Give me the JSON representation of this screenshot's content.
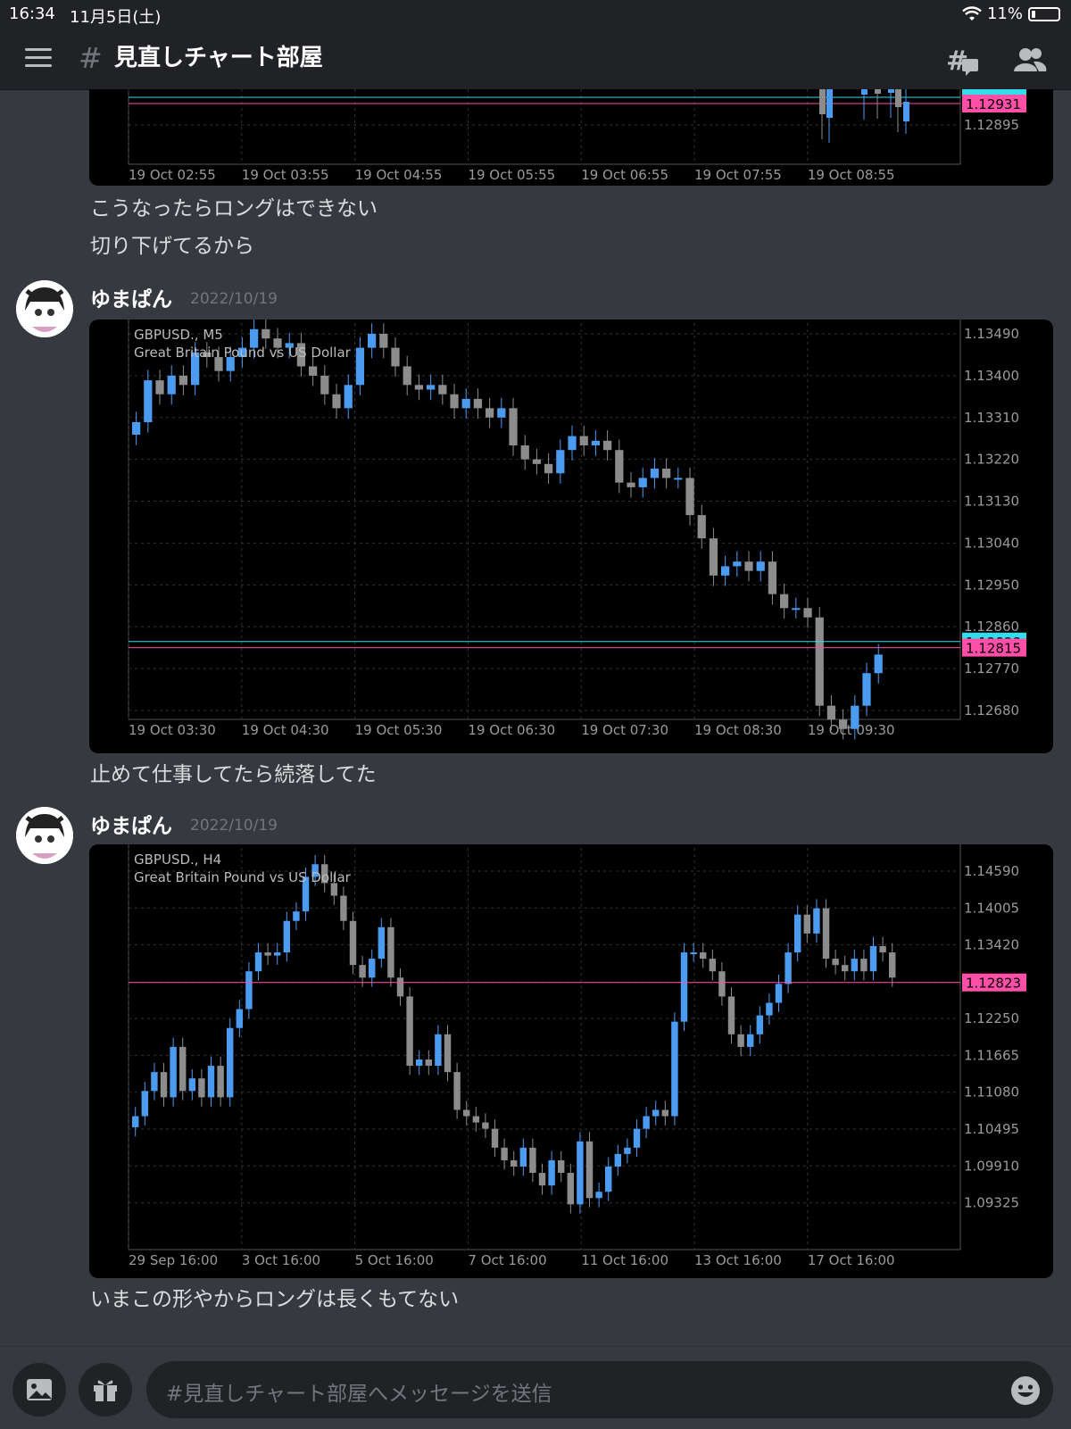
{
  "status": {
    "time": "16:34",
    "date": "11月5日(土)",
    "battery": "11%"
  },
  "header": {
    "hash": "#",
    "title": "見直しチャート部屋",
    "threads_icon": "threads-icon",
    "members_icon": "members-icon"
  },
  "messages_top": {
    "line1": "こうなったらロングはできない",
    "line2": "切り下げてるから"
  },
  "msg2": {
    "username": "ゆまぱん",
    "timestamp": "2022/10/19",
    "text": "止めて仕事してたら続落してた"
  },
  "msg3": {
    "username": "ゆまぱん",
    "timestamp": "2022/10/19",
    "text": "いまこの形やからロングは長くもてない"
  },
  "input": {
    "placeholder": "#見直しチャート部屋へメッセージを送信"
  },
  "colors": {
    "bg": "#36393f",
    "bar": "#202225",
    "bull": "#4b9cf0",
    "bear": "#8c8c8c",
    "price_tag": "#ff4fa7",
    "cyan_tag": "#33ddee"
  },
  "chart_data": [
    {
      "type": "candlestick",
      "symbol": "",
      "title": "",
      "y_ticks": [
        "1.12895"
      ],
      "x_ticks": [
        "19 Oct 02:55",
        "19 Oct 03:55",
        "19 Oct 04:55",
        "19 Oct 05:55",
        "19 Oct 06:55",
        "19 Oct 07:55",
        "19 Oct 08:55"
      ],
      "current_price": "1.12931",
      "cyan_price": "1.12941"
    },
    {
      "type": "candlestick",
      "symbol": "GBPUSD., M5",
      "title": "Great Britain Pound vs US Dollar",
      "y_ticks": [
        "1.13490",
        "1.13400",
        "1.13310",
        "1.13220",
        "1.13130",
        "1.13040",
        "1.12950",
        "1.12860",
        "1.12770",
        "1.12680"
      ],
      "x_ticks": [
        "19 Oct 03:30",
        "19 Oct 04:30",
        "19 Oct 05:30",
        "19 Oct 06:30",
        "19 Oct 07:30",
        "19 Oct 08:30",
        "19 Oct 09:30"
      ],
      "current_price": "1.12815",
      "cyan_price": "1.12828",
      "closes": [
        1.133,
        1.1339,
        1.1336,
        1.134,
        1.1338,
        1.1345,
        1.1344,
        1.1341,
        1.1344,
        1.1346,
        1.135,
        1.1348,
        1.1346,
        1.1347,
        1.1342,
        1.134,
        1.1336,
        1.1333,
        1.1338,
        1.1346,
        1.1349,
        1.1346,
        1.1342,
        1.1338,
        1.1337,
        1.1338,
        1.1336,
        1.1333,
        1.1335,
        1.1333,
        1.1331,
        1.1333,
        1.1325,
        1.1322,
        1.1321,
        1.1319,
        1.1324,
        1.1327,
        1.1325,
        1.1326,
        1.1324,
        1.1317,
        1.1316,
        1.1318,
        1.132,
        1.1318,
        1.1318,
        1.131,
        1.1305,
        1.1297,
        1.1299,
        1.13,
        1.1298,
        1.13,
        1.1293,
        1.129,
        1.129,
        1.1288,
        1.1269,
        1.1266,
        1.1264,
        1.1269,
        1.1276,
        1.128
      ]
    },
    {
      "type": "candlestick",
      "symbol": "GBPUSD., H4",
      "title": "Great Britain Pound vs US Dollar",
      "y_ticks": [
        "1.14590",
        "1.14005",
        "1.13420",
        "1.12823",
        "1.12250",
        "1.11665",
        "1.11080",
        "1.10495",
        "1.09910",
        "1.09325"
      ],
      "x_ticks": [
        "29 Sep 16:00",
        "3 Oct 16:00",
        "5 Oct 16:00",
        "7 Oct 16:00",
        "11 Oct 16:00",
        "13 Oct 16:00",
        "17 Oct 16:00"
      ],
      "current_price": "1.12823",
      "closes": [
        1.107,
        1.111,
        1.114,
        1.11,
        1.118,
        1.111,
        1.113,
        1.11,
        1.115,
        1.11,
        1.121,
        1.124,
        1.13,
        1.133,
        1.1325,
        1.133,
        1.138,
        1.1395,
        1.145,
        1.147,
        1.144,
        1.142,
        1.138,
        1.131,
        1.129,
        1.132,
        1.137,
        1.129,
        1.126,
        1.115,
        1.116,
        1.115,
        1.12,
        1.114,
        1.108,
        1.107,
        1.106,
        1.105,
        1.102,
        1.1,
        1.099,
        1.102,
        1.098,
        1.096,
        1.1,
        1.098,
        1.093,
        1.103,
        1.094,
        1.095,
        1.099,
        1.101,
        1.102,
        1.105,
        1.107,
        1.108,
        1.107,
        1.122,
        1.133,
        1.133,
        1.132,
        1.13,
        1.126,
        1.12,
        1.118,
        1.12,
        1.123,
        1.125,
        1.128,
        1.133,
        1.139,
        1.136,
        1.14,
        1.132,
        1.131,
        1.13,
        1.132,
        1.13,
        1.134,
        1.133,
        1.129
      ]
    }
  ]
}
